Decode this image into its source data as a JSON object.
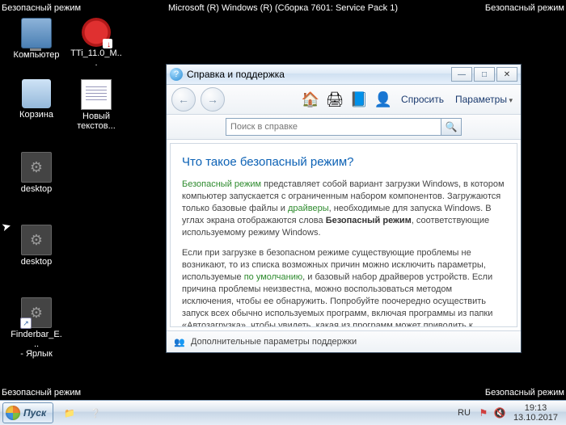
{
  "safe_mode_label": "Безопасный режим",
  "os_title": "Microsoft (R) Windows (R) (Сборка 7601: Service Pack 1)",
  "desktop": {
    "computer": "Компьютер",
    "av": "TTi_11.0_M...",
    "bin": "Корзина",
    "txt": "Новый текстов...",
    "ini1": "desktop",
    "ini2": "desktop",
    "shortcut": "Finderbar_E...\n- Ярлык"
  },
  "help": {
    "title": "Справка и поддержка",
    "ask": "Спросить",
    "options": "Параметры",
    "search_placeholder": "Поиск в справке",
    "heading": "Что такое безопасный режим?",
    "p1a": "Безопасный режим",
    "p1b": " представляет собой вариант загрузки Windows, в котором компьютер запускается с ограниченным набором компонентов. Загружаются только базовые файлы и ",
    "p1c": "драйверы",
    "p1d": ", необходимые для запуска Windows. В углах экрана отображаются слова ",
    "p1e": "Безопасный режим",
    "p1f": ", соответствующие используемому режиму Windows.",
    "p2a": "Если при загрузке в безопасном режиме существующие проблемы не возникают, то из списка возможных причин можно исключить параметры, используемые ",
    "p2b": "по умолчанию",
    "p2c": ", и базовый набор драйверов устройств. Если причина проблемы неизвестна, можно воспользоваться методом исключения, чтобы ее обнаружить. Попробуйте поочередно осуществить запуск всех обычно используемых программ, включая программы из папки «Автозагрузка», чтобы увидеть, какая из программ может приводить к возникновению проблемы.",
    "footer": "Дополнительные параметры поддержки"
  },
  "taskbar": {
    "start": "Пуск",
    "lang": "RU",
    "time": "19:13",
    "date": "13.10.2017"
  }
}
